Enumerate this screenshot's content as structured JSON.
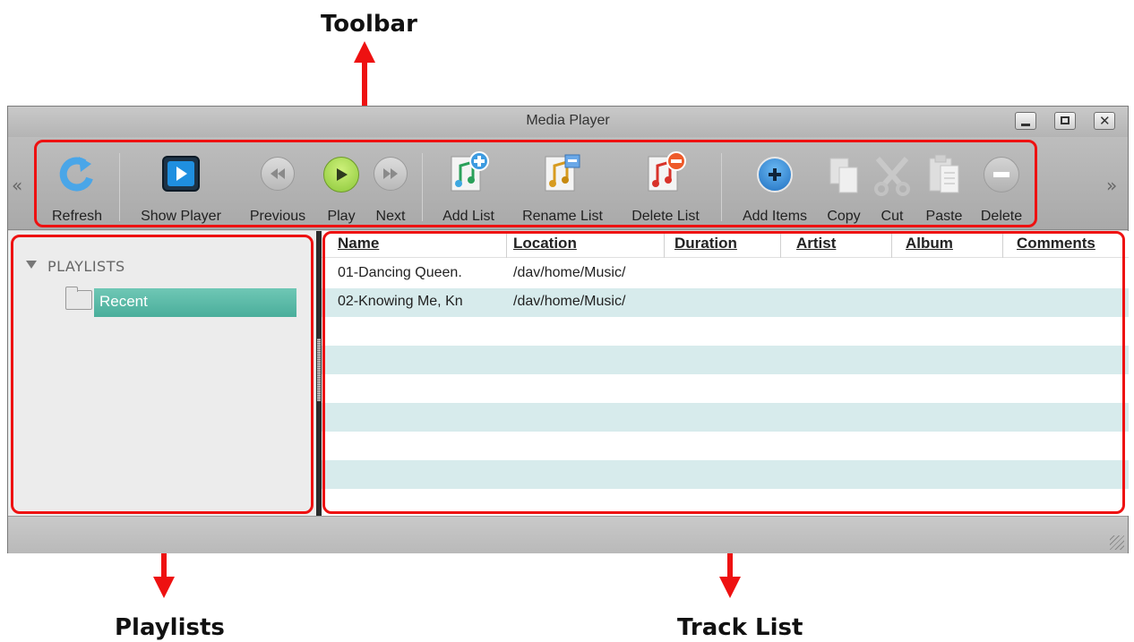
{
  "callouts": {
    "toolbar": "Toolbar",
    "playlists": "Playlists",
    "track_list": "Track List"
  },
  "window": {
    "title": "Media Player",
    "controls": [
      "minimize-icon",
      "maximize-icon",
      "close-icon"
    ],
    "close_glyph": "✕"
  },
  "toolbar": {
    "scroll_left": "«",
    "scroll_right": "»",
    "refresh": "Refresh",
    "show_player": "Show Player",
    "previous": "Previous",
    "play": "Play",
    "next": "Next",
    "add_list": "Add List",
    "rename_list": "Rename List",
    "delete_list": "Delete List",
    "add_items": "Add Items",
    "copy": "Copy",
    "cut": "Cut",
    "paste": "Paste",
    "delete": "Delete"
  },
  "playlists": {
    "header": "PLAYLISTS",
    "items": [
      {
        "label": "Recent",
        "selected": true
      }
    ]
  },
  "track_list": {
    "columns": [
      "Name",
      "Location",
      "Duration",
      "Artist",
      "Album",
      "Comments"
    ],
    "rows": [
      {
        "name": "01-Dancing Queen.",
        "location": "/dav/home/Music/",
        "duration": "",
        "artist": "",
        "album": "",
        "comments": ""
      },
      {
        "name": "02-Knowing Me, Kn",
        "location": "/dav/home/Music/",
        "duration": "",
        "artist": "",
        "album": "",
        "comments": ""
      }
    ]
  },
  "colors": {
    "highlight": "#ee1111",
    "selection": "#4aae9b",
    "row_alt": "#d7ebec"
  }
}
